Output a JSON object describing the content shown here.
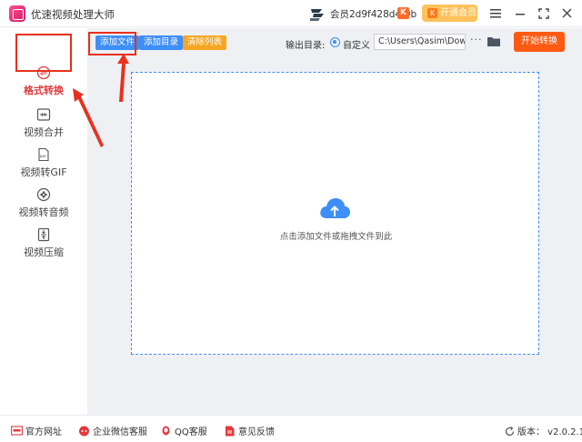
{
  "window": {
    "title": "优速视频处理大师",
    "member_text": "会员2d9f428d4f0b",
    "member_badge": "K",
    "vip_button": "开通会员",
    "vip_badge": "K"
  },
  "sidebar": {
    "items": [
      {
        "label": "格式转换",
        "icon": "format-convert-icon",
        "active": true
      },
      {
        "label": "视频合并",
        "icon": "video-merge-icon"
      },
      {
        "label": "视频转GIF",
        "icon": "gif-icon"
      },
      {
        "label": "视频转音频",
        "icon": "audio-icon"
      },
      {
        "label": "视频压缩",
        "icon": "compress-icon"
      }
    ]
  },
  "toolbar": {
    "add_file": "添加文件",
    "add_dir": "添加目录",
    "clear_list": "清除列表",
    "output_label": "输出目录:",
    "custom_option": "自定义",
    "output_path": "C:\\Users\\Qasim\\Downloads",
    "more": "···",
    "start_button": "开始转换"
  },
  "dropzone": {
    "hint": "点击添加文件或拖拽文件到此"
  },
  "footer": {
    "website": "官方网址",
    "wechat_service": "企业微信客服",
    "qq_service": "QQ客服",
    "feedback": "意见反馈",
    "version": "版本： v2.0.2.1"
  },
  "colors": {
    "accent_blue": "#3e8ef7",
    "orange": "#f6a623",
    "start_orange": "#ff5a13",
    "highlight_red": "#e8301d"
  }
}
